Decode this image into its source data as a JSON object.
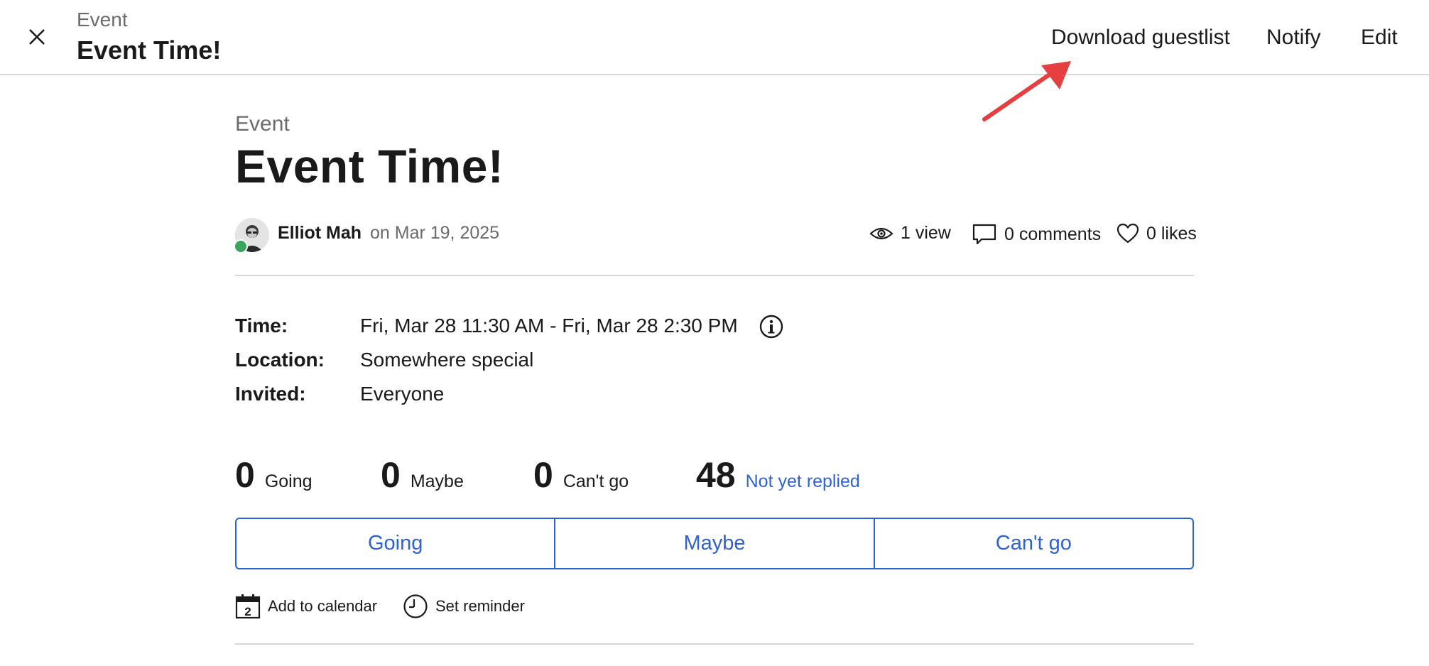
{
  "header": {
    "kicker": "Event",
    "title": "Event Time!",
    "actions": {
      "download": "Download guestlist",
      "notify": "Notify",
      "edit": "Edit"
    }
  },
  "post": {
    "kicker": "Event",
    "title": "Event Time!",
    "author": "Elliot Mah",
    "posted": "on Mar 19, 2025",
    "stats": {
      "views": "1 view",
      "comments": "0 comments",
      "likes": "0 likes"
    }
  },
  "details": {
    "time_label": "Time:",
    "time_value": "Fri, Mar 28 11:30 AM - Fri, Mar 28 2:30 PM",
    "location_label": "Location:",
    "location_value": "Somewhere special",
    "invited_label": "Invited:",
    "invited_value": "Everyone"
  },
  "counts": {
    "going": {
      "num": "0",
      "label": "Going"
    },
    "maybe": {
      "num": "0",
      "label": "Maybe"
    },
    "cant_go": {
      "num": "0",
      "label": "Can't go"
    },
    "not_replied": {
      "num": "48",
      "label": "Not yet replied"
    }
  },
  "rsvp": {
    "going": "Going",
    "maybe": "Maybe",
    "cant_go": "Can't go"
  },
  "utilities": {
    "calendar": "Add to calendar",
    "calendar_icon_glyph": "2",
    "reminder": "Set reminder"
  },
  "icons": {
    "close": "close-icon",
    "eye": "eye-icon",
    "comment": "comment-icon",
    "heart": "heart-icon",
    "info": "info-icon",
    "calendar": "calendar-icon",
    "clock": "clock-icon"
  },
  "colors": {
    "accent": "#2f62d2",
    "presence": "#3aa55d",
    "annotation": "#e5403f"
  }
}
